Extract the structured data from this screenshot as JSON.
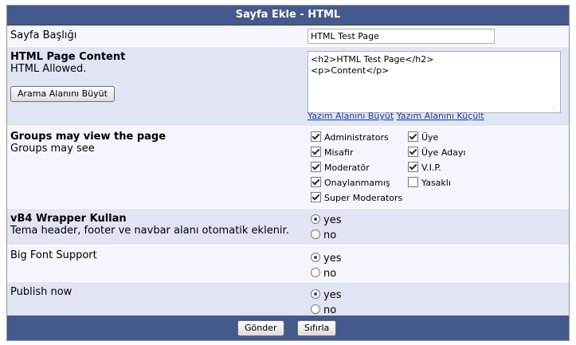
{
  "form": {
    "title": "Sayfa Ekle - HTML",
    "page_title": {
      "label": "Sayfa Başlığı",
      "value": "HTML Test Page"
    },
    "html_content": {
      "label": "HTML Page Content",
      "sublabel": "HTML Allowed.",
      "search_button": "Arama Alanını Büyüt",
      "lines": [
        "<h2>HTML Test Page</h2>",
        "<p>Content</p>"
      ],
      "enlarge_link": "Yazım Alanını Büyüt",
      "shrink_link": "Yazım Alanını Küçült"
    },
    "groups": {
      "label": "Groups may view the page",
      "sublabel": "Groups may see",
      "items": [
        {
          "label": "Administrators",
          "checked": true
        },
        {
          "label": "Üye",
          "checked": true
        },
        {
          "label": "Misafir",
          "checked": true
        },
        {
          "label": "Üye Adayı",
          "checked": true
        },
        {
          "label": "Moderatör",
          "checked": true
        },
        {
          "label": "V.I.P.",
          "checked": true
        },
        {
          "label": "Onaylanmamış",
          "checked": true
        },
        {
          "label": "Yasaklı",
          "checked": false
        },
        {
          "label": "Super Moderators",
          "checked": true
        }
      ]
    },
    "wrapper": {
      "label": "vB4 Wrapper Kullan",
      "sublabel": "Tema header, footer ve navbar alanı otomatik eklenir.",
      "yes": "yes",
      "no": "no",
      "selected": "yes"
    },
    "big_font": {
      "label": "Big Font Support",
      "yes": "yes",
      "no": "no",
      "selected": "yes"
    },
    "publish": {
      "label": "Publish now",
      "yes": "yes",
      "no": "no",
      "selected": "yes"
    },
    "submit_label": "Gönder",
    "reset_label": "Sıfırla"
  }
}
